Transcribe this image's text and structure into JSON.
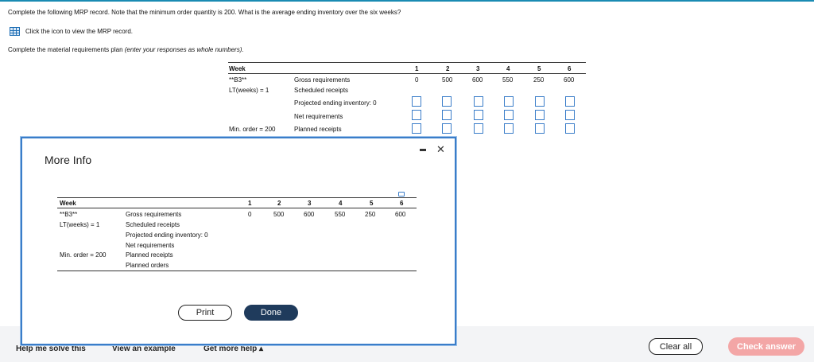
{
  "question": "Complete the following MRP record. Note that the minimum order quantity is 200. What is the average ending inventory over the six weeks?",
  "click_icon_text": "Click the icon to view the MRP record.",
  "instruction_main": "Complete the material requirements plan ",
  "instruction_italic": "(enter your responses as whole numbers).",
  "record": {
    "week_label": "Week",
    "item": "**B3**",
    "lead_time": "LT(weeks) = 1",
    "min_order": "Min. order = 200",
    "weeks": [
      "1",
      "2",
      "3",
      "4",
      "5",
      "6"
    ],
    "rows": {
      "gross": "Gross requirements",
      "scheduled": "Scheduled receipts",
      "projected": "Projected ending inventory: 0",
      "net": "Net requirements",
      "planned_receipts": "Planned receipts"
    },
    "gross_values": [
      "0",
      "500",
      "600",
      "550",
      "250",
      "600"
    ]
  },
  "modal": {
    "title": "More Info",
    "week_label": "Week",
    "item": "**B3**",
    "lead_time": "LT(weeks) = 1",
    "min_order": "Min. order = 200",
    "weeks": [
      "1",
      "2",
      "3",
      "4",
      "5",
      "6"
    ],
    "rows": {
      "gross": "Gross requirements",
      "scheduled": "Scheduled receipts",
      "projected": "Projected ending inventory: 0",
      "net": "Net requirements",
      "planned_receipts": "Planned receipts",
      "planned_orders": "Planned orders"
    },
    "gross_values": [
      "0",
      "500",
      "600",
      "550",
      "250",
      "600"
    ],
    "print_label": "Print",
    "done_label": "Done",
    "close_symbol": "✕"
  },
  "footer": {
    "help_solve": "Help me solve this",
    "view_example": "View an example",
    "get_more_help": "Get more help ▴",
    "clear_all": "Clear all",
    "check_answer": "Check answer"
  },
  "colors": {
    "accent": "#3a7dc9",
    "done_button": "#1f3b5c",
    "check_button": "#f3a6a6"
  }
}
